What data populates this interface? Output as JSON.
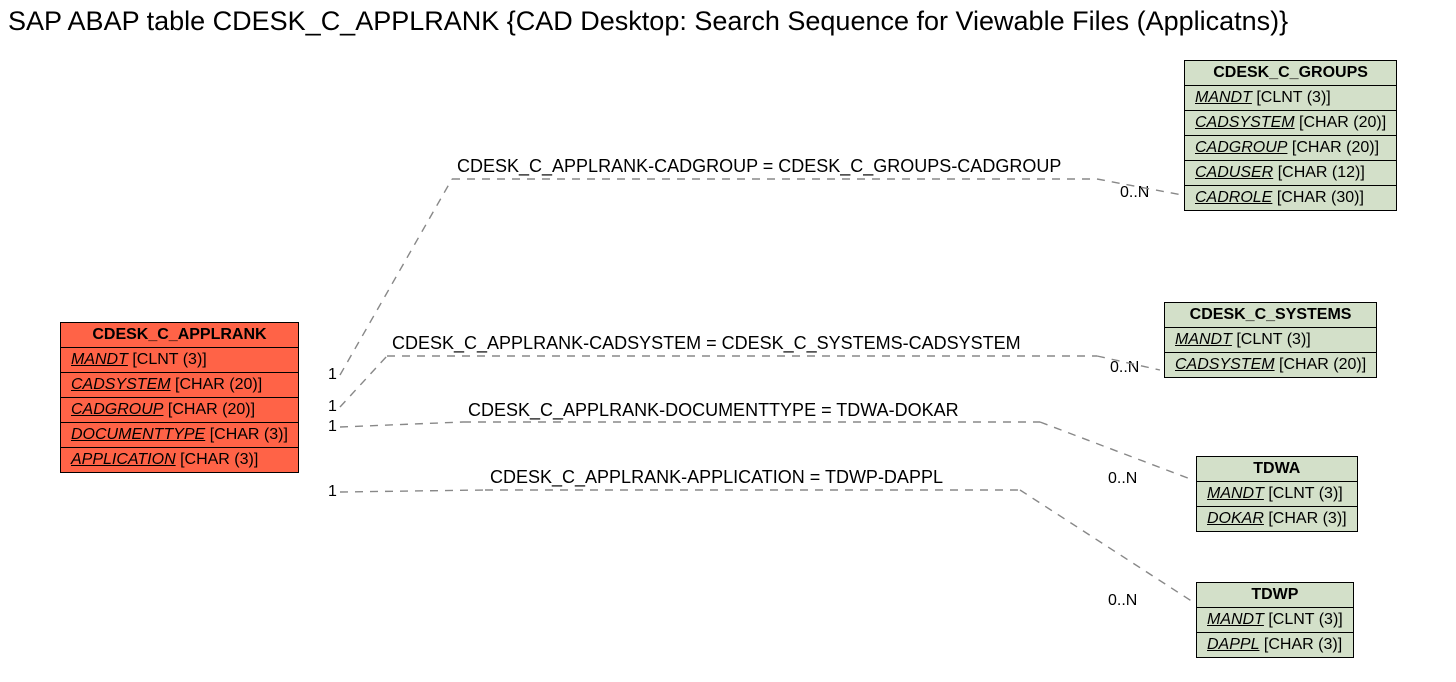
{
  "title": "SAP ABAP table CDESK_C_APPLRANK {CAD Desktop: Search Sequence for Viewable Files (Applicatns)}",
  "mainTable": {
    "name": "CDESK_C_APPLRANK",
    "fields": [
      {
        "name": "MANDT",
        "type": "[CLNT (3)]"
      },
      {
        "name": "CADSYSTEM",
        "type": "[CHAR (20)]"
      },
      {
        "name": "CADGROUP",
        "type": "[CHAR (20)]"
      },
      {
        "name": "DOCUMENTTYPE",
        "type": "[CHAR (3)]"
      },
      {
        "name": "APPLICATION",
        "type": "[CHAR (3)]"
      }
    ]
  },
  "relTables": {
    "groups": {
      "name": "CDESK_C_GROUPS",
      "fields": [
        {
          "name": "MANDT",
          "type": "[CLNT (3)]"
        },
        {
          "name": "CADSYSTEM",
          "type": "[CHAR (20)]"
        },
        {
          "name": "CADGROUP",
          "type": "[CHAR (20)]"
        },
        {
          "name": "CADUSER",
          "type": "[CHAR (12)]"
        },
        {
          "name": "CADROLE",
          "type": "[CHAR (30)]"
        }
      ]
    },
    "systems": {
      "name": "CDESK_C_SYSTEMS",
      "fields": [
        {
          "name": "MANDT",
          "type": "[CLNT (3)]"
        },
        {
          "name": "CADSYSTEM",
          "type": "[CHAR (20)]"
        }
      ]
    },
    "tdwa": {
      "name": "TDWA",
      "fields": [
        {
          "name": "MANDT",
          "type": "[CLNT (3)]"
        },
        {
          "name": "DOKAR",
          "type": "[CHAR (3)]"
        }
      ]
    },
    "tdwp": {
      "name": "TDWP",
      "fields": [
        {
          "name": "MANDT",
          "type": "[CLNT (3)]"
        },
        {
          "name": "DAPPL",
          "type": "[CHAR (3)]"
        }
      ]
    }
  },
  "relations": {
    "r1": "CDESK_C_APPLRANK-CADGROUP = CDESK_C_GROUPS-CADGROUP",
    "r2": "CDESK_C_APPLRANK-CADSYSTEM = CDESK_C_SYSTEMS-CADSYSTEM",
    "r3": "CDESK_C_APPLRANK-DOCUMENTTYPE = TDWA-DOKAR",
    "r4": "CDESK_C_APPLRANK-APPLICATION = TDWP-DAPPL"
  },
  "cardinality": {
    "left": "1",
    "right": "0..N"
  }
}
